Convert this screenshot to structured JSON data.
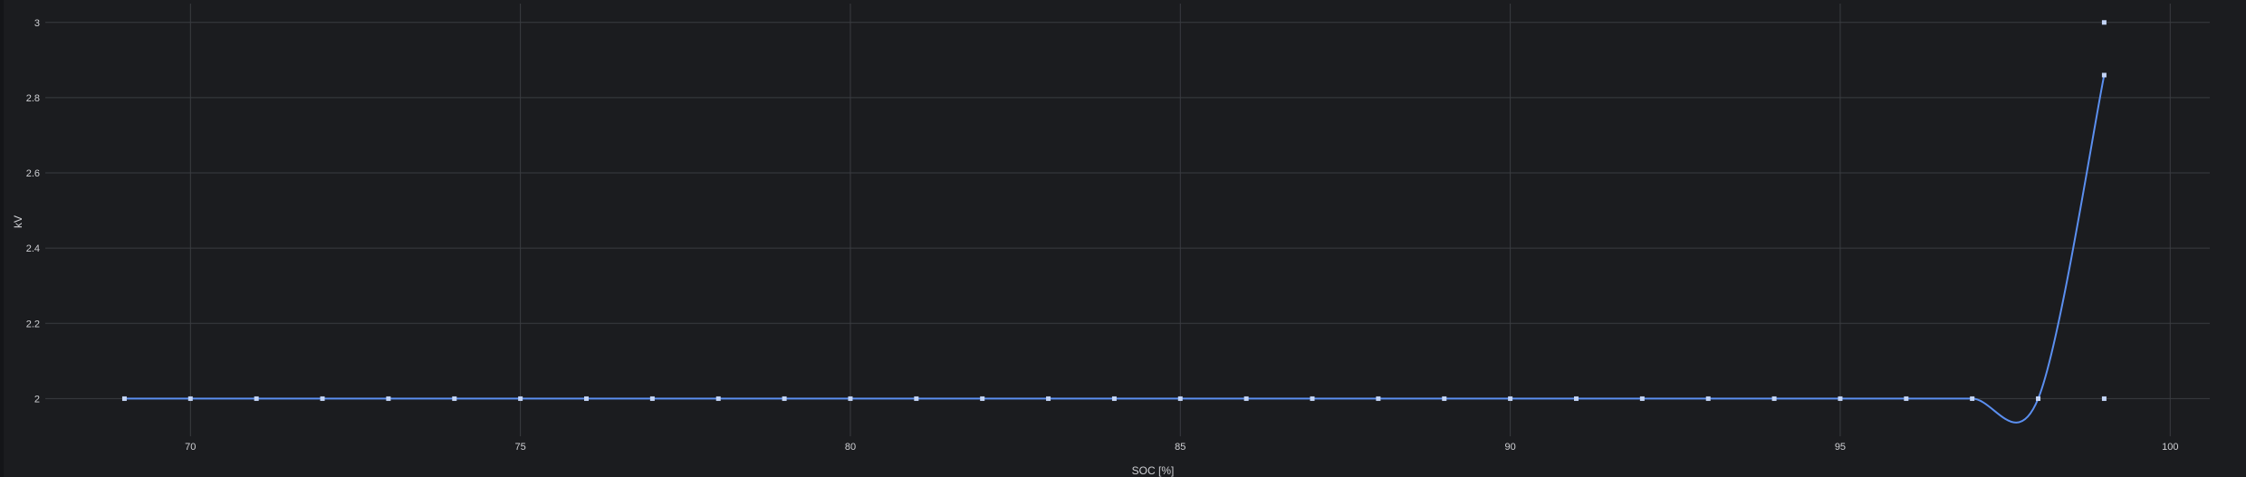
{
  "chart_data": {
    "type": "scatter",
    "title": "",
    "xlabel": "SOC [%]",
    "ylabel": "kV",
    "xlim": [
      67.8,
      100.6
    ],
    "ylim": [
      1.9,
      3.05
    ],
    "x_ticks": [
      70,
      75,
      80,
      85,
      90,
      95,
      100
    ],
    "y_ticks": [
      2,
      2.2,
      2.4,
      2.6,
      2.8,
      3
    ],
    "grid": true,
    "legend": "none",
    "series": [
      {
        "style": "spline-with-markers",
        "color": "#5b8ff0",
        "marker_color": "#c3d4f5",
        "x": [
          69,
          70,
          71,
          72,
          73,
          74,
          75,
          76,
          77,
          78,
          79,
          80,
          81,
          82,
          83,
          84,
          85,
          86,
          87,
          88,
          89,
          90,
          91,
          92,
          93,
          94,
          95,
          96,
          97,
          98,
          99
        ],
        "values": [
          2,
          2,
          2,
          2,
          2,
          2,
          2,
          2,
          2,
          2,
          2,
          2,
          2,
          2,
          2,
          2,
          2,
          2,
          2,
          2,
          2,
          2,
          2,
          2,
          2,
          2,
          2,
          2,
          2,
          2,
          2.86
        ]
      }
    ],
    "extra_points": {
      "marker_color": "#c3d4f5",
      "x": [
        99,
        99
      ],
      "values": [
        3,
        2
      ]
    }
  }
}
